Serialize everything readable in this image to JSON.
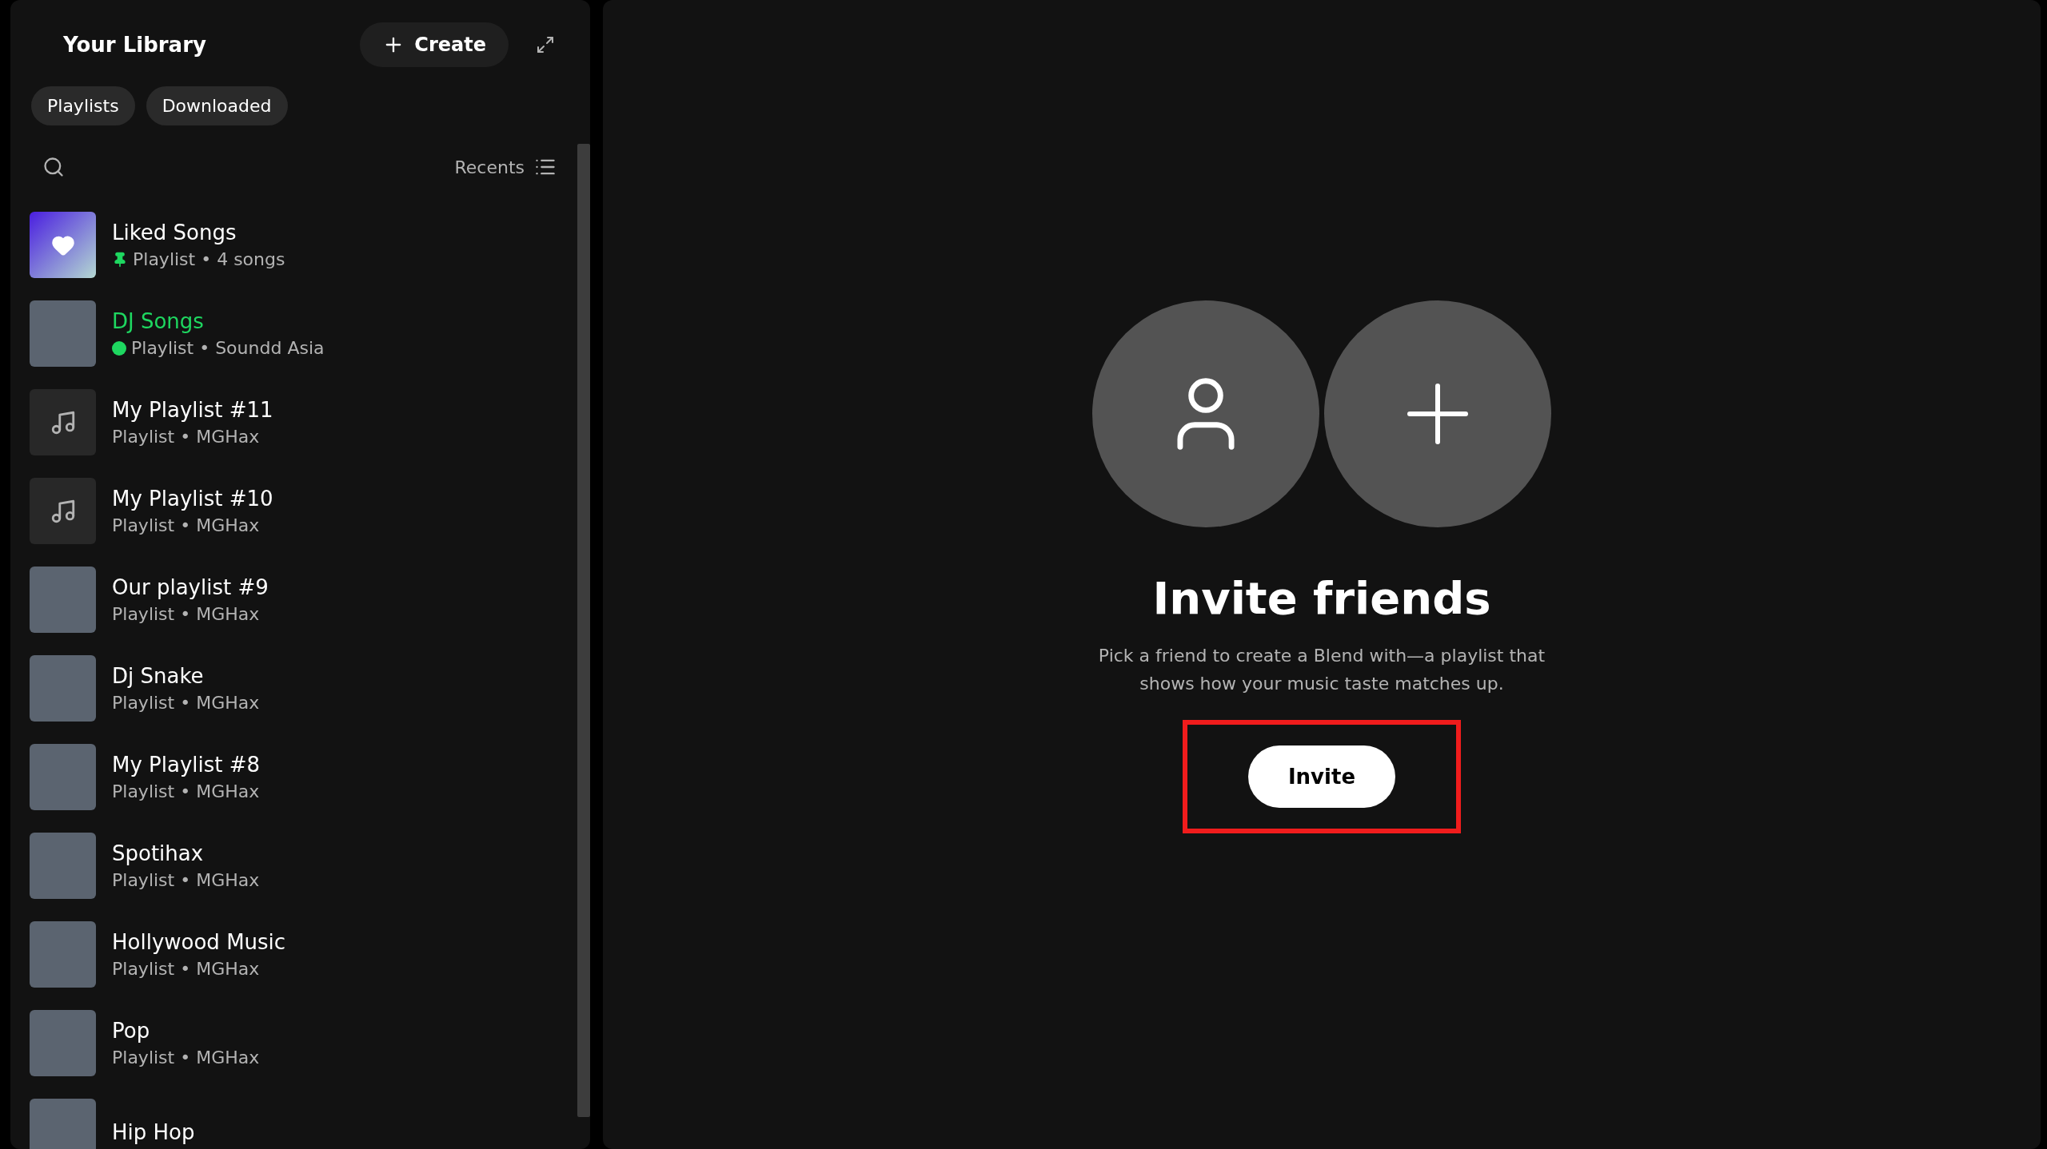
{
  "library": {
    "title": "Your Library",
    "create_label": "Create",
    "filters": [
      {
        "label": "Playlists",
        "selected": false
      },
      {
        "label": "Downloaded",
        "selected": false
      }
    ],
    "sort_label": "Recents",
    "items": [
      {
        "kind": "liked",
        "title": "Liked Songs",
        "subtitle": "Playlist • 4 songs",
        "pinned": true,
        "downloaded": false,
        "playing": false
      },
      {
        "kind": "photo",
        "title": "DJ Songs",
        "subtitle": "Playlist • Soundd Asia",
        "pinned": false,
        "downloaded": true,
        "playing": true
      },
      {
        "kind": "note",
        "title": "My Playlist #11",
        "subtitle": "Playlist • MGHax",
        "pinned": false,
        "downloaded": false,
        "playing": false
      },
      {
        "kind": "note",
        "title": "My Playlist #10",
        "subtitle": "Playlist • MGHax",
        "pinned": false,
        "downloaded": false,
        "playing": false
      },
      {
        "kind": "photo",
        "title": "Our playlist #9",
        "subtitle": "Playlist • MGHax",
        "pinned": false,
        "downloaded": false,
        "playing": false
      },
      {
        "kind": "photo",
        "title": "Dj Snake",
        "subtitle": "Playlist • MGHax",
        "pinned": false,
        "downloaded": false,
        "playing": false
      },
      {
        "kind": "photo",
        "title": "My Playlist #8",
        "subtitle": "Playlist • MGHax",
        "pinned": false,
        "downloaded": false,
        "playing": false
      },
      {
        "kind": "photo",
        "title": "Spotihax",
        "subtitle": "Playlist • MGHax",
        "pinned": false,
        "downloaded": false,
        "playing": false
      },
      {
        "kind": "photo",
        "title": "Hollywood Music",
        "subtitle": "Playlist • MGHax",
        "pinned": false,
        "downloaded": false,
        "playing": false
      },
      {
        "kind": "photo",
        "title": "Pop",
        "subtitle": "Playlist • MGHax",
        "pinned": false,
        "downloaded": false,
        "playing": false
      },
      {
        "kind": "photo",
        "title": "Hip Hop",
        "pinned": false,
        "downloaded": false,
        "playing": false
      }
    ]
  },
  "invite": {
    "title": "Invite friends",
    "description": "Pick a friend to create a Blend with—a playlist that shows how your music taste matches up.",
    "button": "Invite",
    "highlighted": true
  }
}
